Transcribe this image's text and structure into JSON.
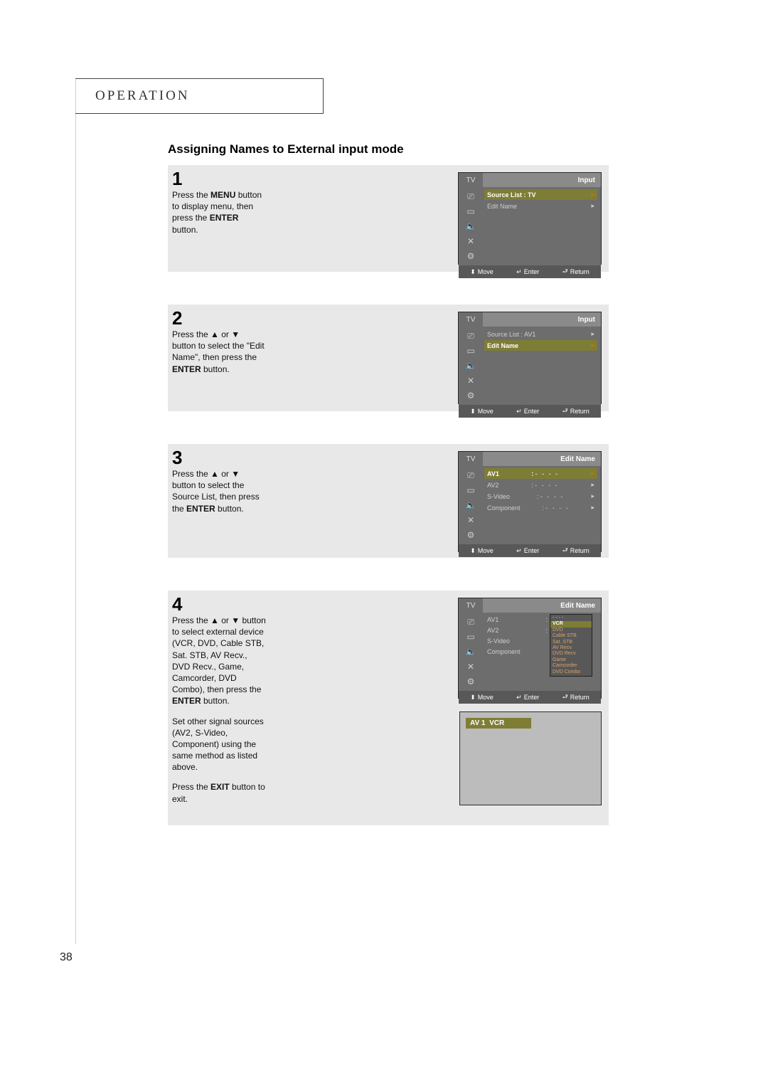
{
  "header": {
    "operation": "OPERATION"
  },
  "title": "Assigning Names to External input mode",
  "page_number": "38",
  "foot": {
    "move": "Move",
    "enter": "Enter",
    "return": "Return"
  },
  "osd_tab": "TV",
  "osd_input_heading": "Input",
  "osd_editname_heading": "Edit Name",
  "source_list_label": "Source List",
  "edit_name_label": "Edit Name",
  "dashes": "- - - -",
  "steps": {
    "s1": {
      "num": "1",
      "text_a": "Press the ",
      "bold_a": "MENU",
      "text_b": " button to display menu, then press the ",
      "bold_b": "ENTER",
      "text_c": " button.",
      "source_value": "TV"
    },
    "s2": {
      "num": "2",
      "text_a": "Press the ▲ or ▼ button to select the \"Edit Name\", then press the ",
      "bold_a": "ENTER",
      "text_b": " button.",
      "source_value": "AV1"
    },
    "s3": {
      "num": "3",
      "text_a": "Press the ▲ or ▼ button to select the Source List, then press the ",
      "bold_a": "ENTER",
      "text_b": " button.",
      "rows": {
        "av1": "AV1",
        "av2": "AV2",
        "svideo": "S-Video",
        "component": "Component"
      }
    },
    "s4": {
      "num": "4",
      "text_a": "Press the ▲ or ▼ button to select external device (VCR, DVD, Cable STB, Sat. STB, AV Recv., DVD Recv., Game, Camcorder, DVD Combo), then press the ",
      "bold_a": "ENTER",
      "text_b": " button.",
      "para2": "Set other signal sources (AV2, S-Video, Component) using the same method as listed above.",
      "para3_a": "Press the ",
      "para3_bold": "EXIT",
      "para3_b": " button to exit.",
      "rows": {
        "av1": "AV1",
        "av2": "AV2",
        "svideo": "S-Video",
        "component": "Component"
      },
      "popup": {
        "top_dashes": "- - - -",
        "items": [
          "VCR",
          "DVD",
          "Cable STB",
          "Sat. STB",
          "AV Recv.",
          "DVD Recv.",
          "Game",
          "Camcorder",
          "DVD Combo"
        ]
      },
      "preview": {
        "label": "AV 1",
        "value": "VCR"
      }
    }
  }
}
